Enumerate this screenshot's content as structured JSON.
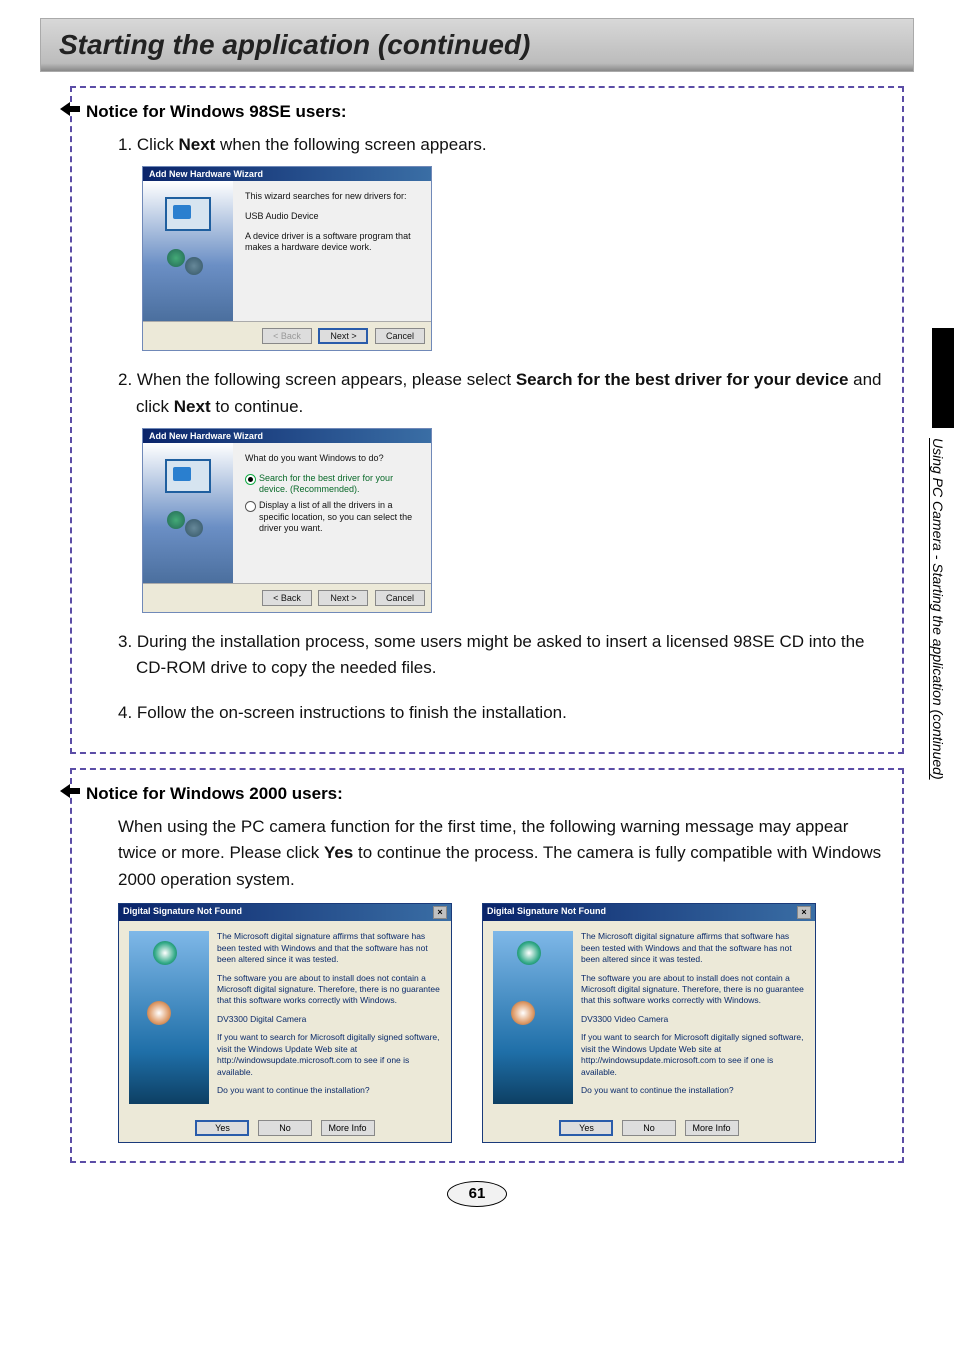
{
  "title": "Starting the application (continued)",
  "side_label": "Using PC Camera - Starting the application (continued)",
  "page_number": "61",
  "notice98": {
    "header": "Notice for Windows 98SE users:",
    "step1_pre": "1. Click ",
    "step1_bold": "Next",
    "step1_post": " when the following screen appears.",
    "step2_pre": "2. When the following screen appears, please select ",
    "step2_bold1": "Search for the best driver for your device",
    "step2_mid": " and click ",
    "step2_bold2": "Next",
    "step2_post": " to continue.",
    "step3": "3. During the installation process, some users might be asked to insert a licensed 98SE CD into the CD-ROM drive to copy the needed files.",
    "step4": "4. Follow the on-screen instructions to finish the installation."
  },
  "wizard1": {
    "title": "Add New Hardware Wizard",
    "line1": "This wizard searches for new drivers for:",
    "device": "USB Audio Device",
    "line2": "A device driver is a software program that makes a hardware device work.",
    "btn_back": "< Back",
    "btn_next": "Next >",
    "btn_cancel": "Cancel"
  },
  "wizard2": {
    "title": "Add New Hardware Wizard",
    "prompt": "What do you want Windows to do?",
    "opt1": "Search for the best driver for your device. (Recommended).",
    "opt2": "Display a list of all the drivers in a specific location, so you can select the driver you want.",
    "btn_back": "< Back",
    "btn_next": "Next >",
    "btn_cancel": "Cancel"
  },
  "notice2000": {
    "header": "Notice for Windows 2000 users:",
    "body_pre": "When using the PC camera function for the first time, the following warning message may appear twice or more. Please click ",
    "body_bold": "Yes",
    "body_post": " to continue the process. The camera is fully compatible with Windows 2000 operation system."
  },
  "dsig": {
    "title": "Digital Signature Not Found",
    "p1": "The Microsoft digital signature affirms that software has been tested with Windows and that the software has not been altered since it was tested.",
    "p2": "The software you are about to install does not contain a Microsoft digital signature. Therefore, there is no guarantee that this software works correctly with Windows.",
    "dev_a": "DV3300 Digital Camera",
    "dev_b": "DV3300 Video Camera",
    "p3": "If you want to search for Microsoft digitally signed software, visit the Windows Update Web site at http://windowsupdate.microsoft.com to see if one is available.",
    "p4": "Do you want to continue the installation?",
    "btn_yes": "Yes",
    "btn_no": "No",
    "btn_more": "More Info"
  }
}
